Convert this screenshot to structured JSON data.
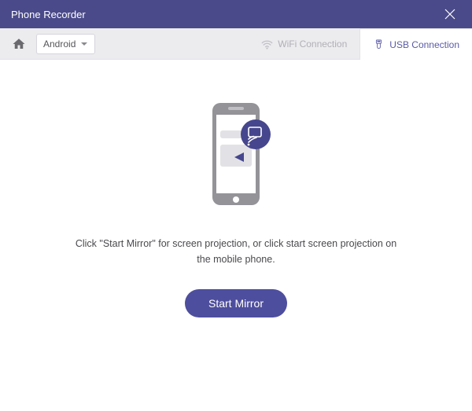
{
  "titlebar": {
    "title": "Phone Recorder"
  },
  "toolbar": {
    "platform_label": "Android",
    "tabs": {
      "wifi": {
        "label": "WiFi Connection",
        "active": false
      },
      "usb": {
        "label": "USB Connection",
        "active": true
      }
    }
  },
  "content": {
    "instruction": "Click \"Start Mirror\" for screen projection, or click start screen projection on the mobile phone.",
    "start_button_label": "Start Mirror"
  },
  "colors": {
    "titlebar_bg": "#4a4a8a",
    "accent": "#4e4e9e",
    "active_tab": "#5a5aa8"
  },
  "icons": {
    "home": "home-icon",
    "close": "close-icon",
    "chevron_down": "chevron-down-icon",
    "wifi": "wifi-icon",
    "usb": "usb-icon",
    "phone_cast": "phone-cast-icon"
  }
}
